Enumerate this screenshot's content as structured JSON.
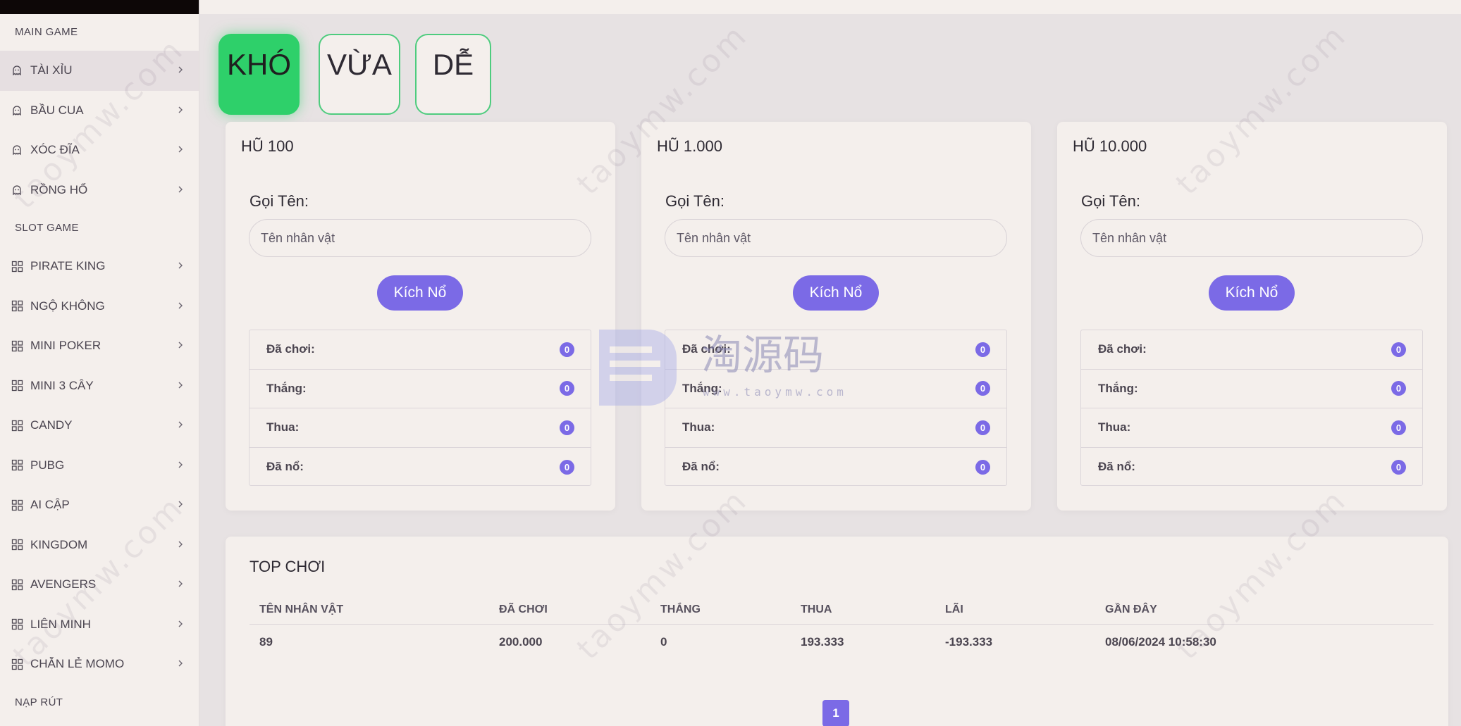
{
  "sidebar": {
    "sections": [
      {
        "header": "MAIN GAME"
      },
      {
        "header": "SLOT GAME"
      },
      {
        "header": "NẠP RÚT"
      }
    ],
    "main_items": [
      {
        "label": "TÀI XỈU",
        "icon": "ghost-icon"
      },
      {
        "label": "BẦU CUA",
        "icon": "ghost-icon"
      },
      {
        "label": "XÓC ĐĨA",
        "icon": "ghost-icon"
      },
      {
        "label": "RỒNG HỔ",
        "icon": "ghost-icon"
      }
    ],
    "slot_items": [
      {
        "label": "PIRATE KING",
        "icon": "grid-icon"
      },
      {
        "label": "NGỘ KHÔNG",
        "icon": "grid-icon"
      },
      {
        "label": "MINI POKER",
        "icon": "grid-icon"
      },
      {
        "label": "MINI 3 CÂY",
        "icon": "grid-icon"
      },
      {
        "label": "CANDY",
        "icon": "grid-icon"
      },
      {
        "label": "PUBG",
        "icon": "grid-icon"
      },
      {
        "label": "AI CẬP",
        "icon": "grid-icon"
      },
      {
        "label": "KINGDOM",
        "icon": "grid-icon"
      },
      {
        "label": "AVENGERS",
        "icon": "grid-icon"
      },
      {
        "label": "LIÊN MINH",
        "icon": "grid-icon"
      },
      {
        "label": "CHẴN LẺ MOMO",
        "icon": "grid-icon"
      }
    ]
  },
  "tabs": [
    {
      "label": "KHÓ"
    },
    {
      "label": "VỪA"
    },
    {
      "label": "DỄ"
    }
  ],
  "jackpots": [
    {
      "title": "HŨ 100",
      "name_label": "Gọi Tên:",
      "name_placeholder": "Tên nhân vật",
      "button": "Kích Nổ",
      "stats": [
        {
          "label": "Đã chơi:",
          "value": "0"
        },
        {
          "label": "Thắng:",
          "value": "0"
        },
        {
          "label": "Thua:",
          "value": "0"
        },
        {
          "label": "Đã nổ:",
          "value": "0"
        }
      ]
    },
    {
      "title": "HŨ 1.000",
      "name_label": "Gọi Tên:",
      "name_placeholder": "Tên nhân vật",
      "button": "Kích Nổ",
      "stats": [
        {
          "label": "Đã chơi:",
          "value": "0"
        },
        {
          "label": "Thắng:",
          "value": "0"
        },
        {
          "label": "Thua:",
          "value": "0"
        },
        {
          "label": "Đã nổ:",
          "value": "0"
        }
      ]
    },
    {
      "title": "HŨ 10.000",
      "name_label": "Gọi Tên:",
      "name_placeholder": "Tên nhân vật",
      "button": "Kích Nổ",
      "stats": [
        {
          "label": "Đã chơi:",
          "value": "0"
        },
        {
          "label": "Thắng:",
          "value": "0"
        },
        {
          "label": "Thua:",
          "value": "0"
        },
        {
          "label": "Đã nổ:",
          "value": "0"
        }
      ]
    }
  ],
  "top": {
    "title": "TOP CHƠI",
    "columns": [
      "TÊN NHÂN VẬT",
      "ĐÃ CHƠI",
      "THẮNG",
      "THUA",
      "LÃI",
      "GẦN ĐÂY"
    ],
    "rows": [
      [
        "89",
        "200.000",
        "0",
        "193.333",
        "-193.333",
        "08/06/2024 10:58:30"
      ]
    ],
    "page": "1"
  },
  "watermark": {
    "text": "taoymw.com",
    "logo_text": "淘源码",
    "logo_sub": "www.taoymw.com"
  },
  "colors": {
    "accent": "#7b6ae6",
    "active_tab": "#2ed06a",
    "tab_border": "#4ecc7e",
    "card_bg": "#f4efec",
    "page_bg": "#e7e2e3"
  }
}
